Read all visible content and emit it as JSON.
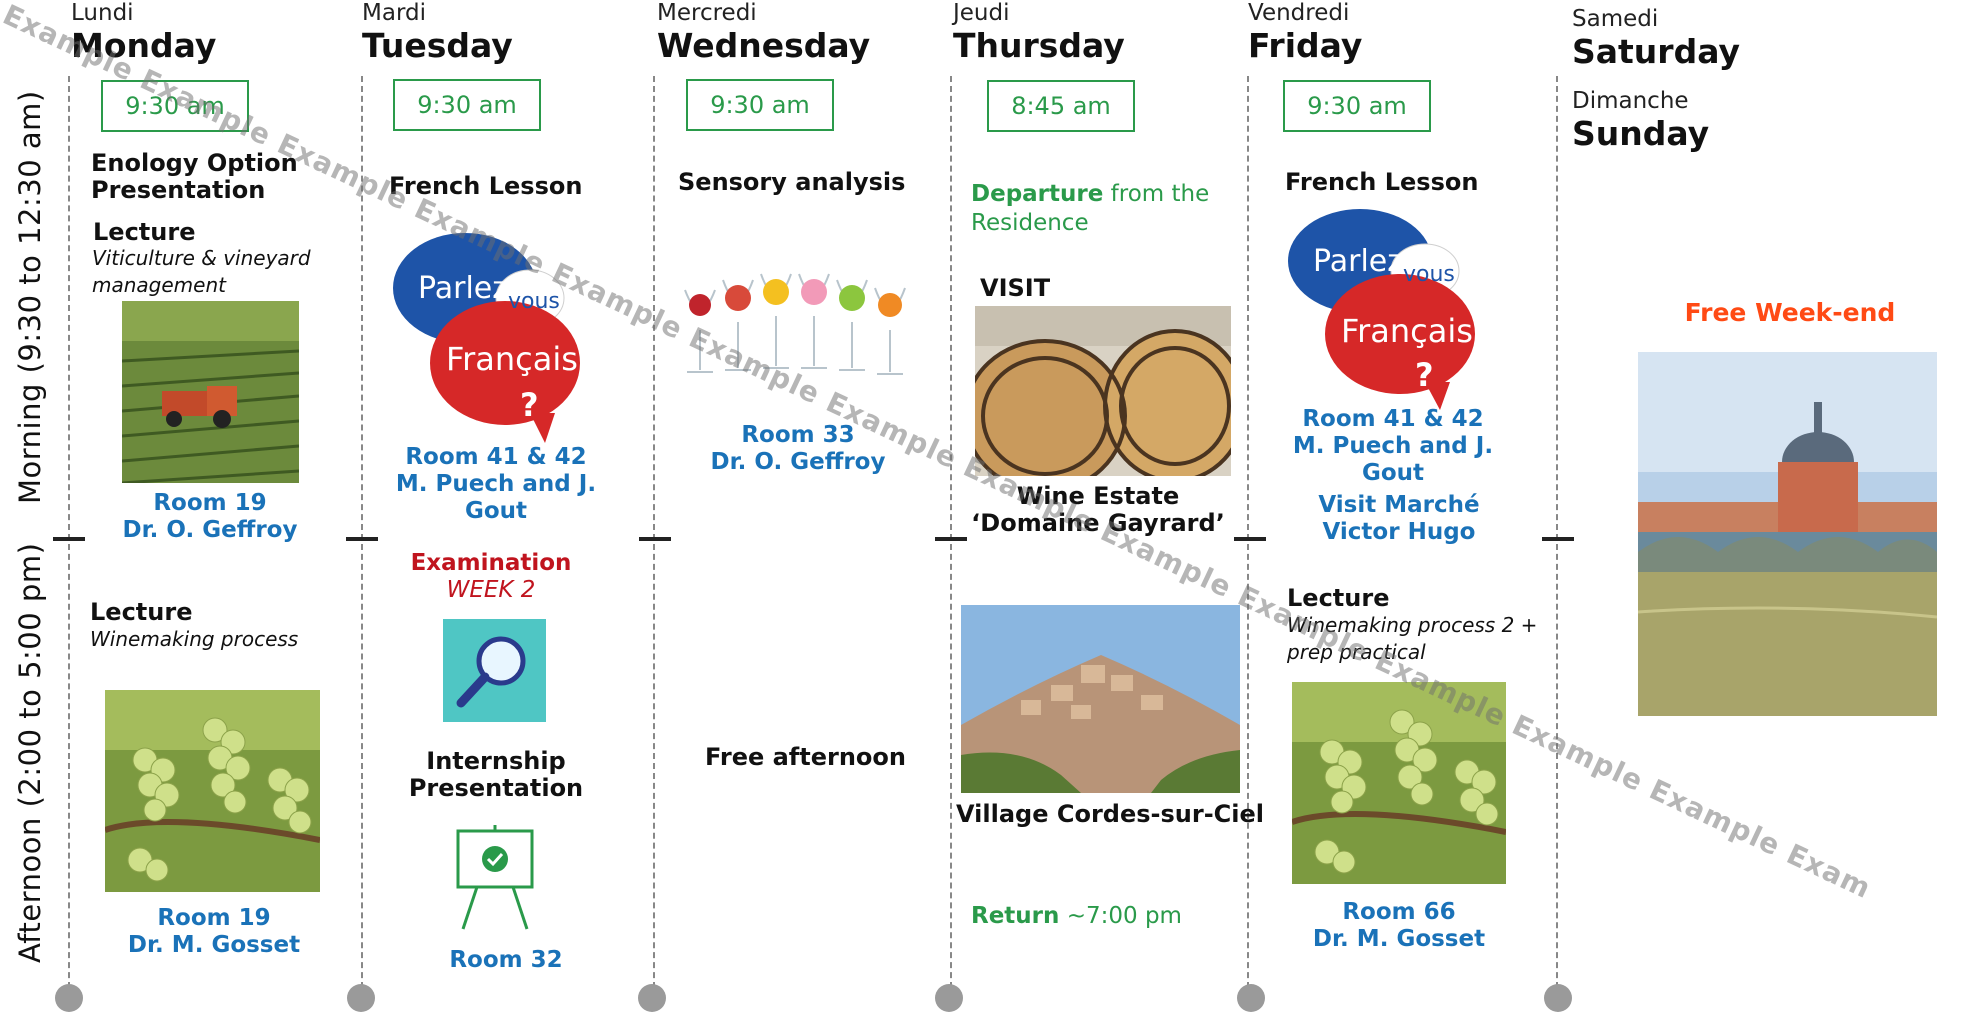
{
  "side_labels": {
    "morning": "Morning (9:30 to 12:30 am)",
    "afternoon": "Afternoon (2:00 to 5:00 pm)"
  },
  "days": {
    "monday": {
      "fr": "Lundi",
      "en": "Monday"
    },
    "tuesday": {
      "fr": "Mardi",
      "en": "Tuesday"
    },
    "wednesday": {
      "fr": "Mercredi",
      "en": "Wednesday"
    },
    "thursday": {
      "fr": "Jeudi",
      "en": "Thursday"
    },
    "friday": {
      "fr": "Vendredi",
      "en": "Friday"
    },
    "saturday": {
      "fr": "Samedi",
      "en": "Saturday"
    },
    "sunday": {
      "fr": "Dimanche",
      "en": "Sunday"
    }
  },
  "monday": {
    "time": "9:30 am",
    "title_line1": "Enology Option",
    "title_line2": "Presentation",
    "lecture_label": "Lecture",
    "lecture_topic_line1": "Viticulture & vineyard",
    "lecture_topic_line2": "management",
    "am_room": "Room 19",
    "am_teacher": "Dr. O. Geffroy",
    "pm_lecture_label": "Lecture",
    "pm_lecture_topic": "Winemaking process",
    "pm_room": "Room 19",
    "pm_teacher": "Dr. M. Gosset"
  },
  "tuesday": {
    "time": "9:30 am",
    "title": "French Lesson",
    "logo_text_1": "Parlez-",
    "logo_text_2": "vous",
    "logo_text_3": "Français",
    "logo_text_4": "?",
    "am_room": "Room 41 & 42",
    "am_teacher_line1": "M. Puech and J.",
    "am_teacher_line2": "Gout",
    "exam_label": "Examination",
    "exam_week": "WEEK 2",
    "internship_line1": "Internship",
    "internship_line2": "Presentation",
    "pm_room": "Room 32"
  },
  "wednesday": {
    "time": "9:30 am",
    "title": "Sensory analysis",
    "am_room": "Room 33",
    "am_teacher": "Dr. O. Geffroy",
    "pm_note": "Free afternoon"
  },
  "thursday": {
    "time": "8:45 am",
    "departure_bold": "Departure",
    "departure_rest": " from the",
    "departure_line2": "Residence",
    "visit_label": "VISIT",
    "estate_line1": "Wine Estate",
    "estate_line2": "‘Domaine Gayrard’",
    "village": "Village Cordes-sur-Ciel",
    "return_bold": "Return",
    "return_time": " ~7:00 pm"
  },
  "friday": {
    "time": "9:30 am",
    "title": "French Lesson",
    "am_room": "Room 41 & 42",
    "am_teacher_line1": "M. Puech and J.",
    "am_teacher_line2": "Gout",
    "visit_line1": "Visit Marché",
    "visit_line2": "Victor Hugo",
    "pm_lecture_label": "Lecture",
    "pm_topic_line1": "Winemaking process 2 +",
    "pm_topic_line2": "prep practical",
    "pm_room": "Room 66",
    "pm_teacher": "Dr. M. Gosset"
  },
  "weekend": {
    "title": "Free Week-end"
  },
  "watermark": {
    "text": "Example Example Example Example Example Example Example Example Example Example Example Example Example Exam"
  },
  "colors": {
    "green": "#2a9a4a",
    "blue": "#1a72b8",
    "red": "#c0141e",
    "orange": "#ff4a14"
  }
}
